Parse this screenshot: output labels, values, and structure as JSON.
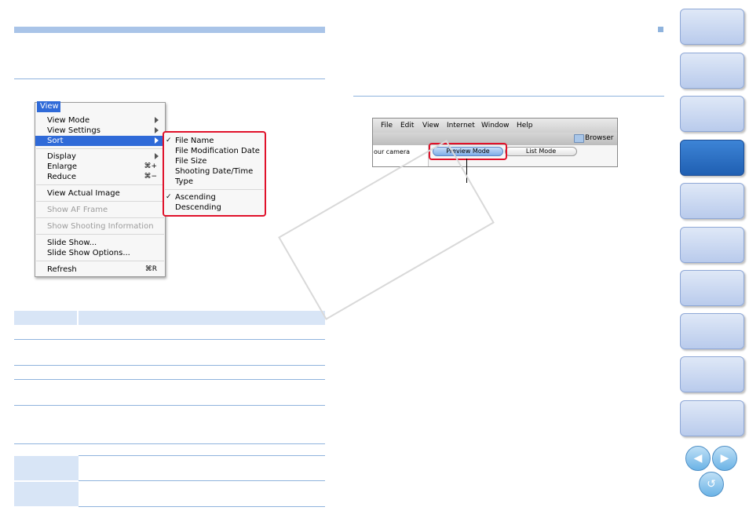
{
  "menu": {
    "title": "View",
    "items": {
      "view_mode": "View Mode",
      "view_settings": "View Settings",
      "sort": "Sort",
      "display": "Display",
      "enlarge": "Enlarge",
      "enlarge_shortcut": "⌘+",
      "reduce": "Reduce",
      "reduce_shortcut": "⌘−",
      "view_actual_image": "View Actual Image",
      "show_af_frame": "Show AF Frame",
      "show_shooting_information": "Show Shooting Information",
      "slide_show": "Slide Show...",
      "slide_show_options": "Slide Show Options...",
      "refresh": "Refresh",
      "refresh_shortcut": "⌘R"
    },
    "sort_submenu": {
      "check": "✓",
      "file_name": "File Name",
      "file_modification_date": "File Modification Date",
      "file_size": "File Size",
      "shooting_date_time": "Shooting Date/Time",
      "type": "Type",
      "ascending": "Ascending",
      "descending": "Descending"
    }
  },
  "app_window": {
    "menubar": [
      "File",
      "Edit",
      "View",
      "Internet",
      "Window",
      "Help"
    ],
    "browser_label": "Browser",
    "left_text": "our camera",
    "preview_mode": "Preview Mode",
    "list_mode": "List Mode"
  },
  "nav": {
    "prev_glyph": "◀",
    "next_glyph": "▶",
    "back_glyph": "↺"
  },
  "colors": {
    "accent": "#a9c4e8",
    "highlight": "#e0112a",
    "menu_selection": "#2f6ad8",
    "tab_active": "#2a6cc0"
  }
}
